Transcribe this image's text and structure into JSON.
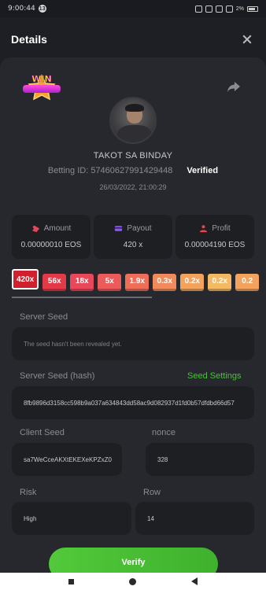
{
  "status_bar": {
    "time": "9:00:44",
    "notification_count": "13",
    "battery_text": "2%"
  },
  "header": {
    "title": "Details"
  },
  "bet": {
    "username": "TAKOT SA BINDAY",
    "betting_id": "Betting ID: 57460627991429448",
    "verified_label": "Verified",
    "date": "26/03/2022, 21:00:29",
    "badge_text": "WIN"
  },
  "stats": {
    "amount": {
      "label": "Amount",
      "value": "0.00000010 EOS",
      "icon": "coins-icon",
      "color": "#e8455a"
    },
    "payout": {
      "label": "Payout",
      "value": "420 x",
      "icon": "card-icon",
      "color": "#8c5cf0"
    },
    "profit": {
      "label": "Profit",
      "value": "0.00004190 EOS",
      "icon": "profit-icon",
      "color": "#e84545"
    }
  },
  "multipliers": [
    {
      "label": "420x",
      "color": "#d0202e",
      "active": true
    },
    {
      "label": "56x",
      "color": "#e23a48",
      "active": false
    },
    {
      "label": "18x",
      "color": "#e8485a",
      "active": false
    },
    {
      "label": "5x",
      "color": "#ec5a5a",
      "active": false
    },
    {
      "label": "1.9x",
      "color": "#ee6e5a",
      "active": false
    },
    {
      "label": "0.3x",
      "color": "#f08a5c",
      "active": false
    },
    {
      "label": "0.2x",
      "color": "#f3a35e",
      "active": false
    },
    {
      "label": "0.2x",
      "color": "#f5b863",
      "active": false
    },
    {
      "label": "0.2",
      "color": "#f3a35e",
      "active": false
    }
  ],
  "server_seed": {
    "label": "Server Seed",
    "value": "The seed hasn't been revealed yet."
  },
  "server_seed_hash": {
    "label": "Server Seed (hash)",
    "value": "8fb9896d3158cc598b9a037a634843dd58ac9d082937d1fd0b57dfdbd66d57",
    "settings_label": "Seed Settings"
  },
  "client_seed": {
    "label": "Client Seed",
    "value": "sa7WeCceAKXtEKEXeKPZxZ0"
  },
  "nonce": {
    "label": "nonce",
    "value": "328"
  },
  "risk": {
    "label": "Risk",
    "value": "High"
  },
  "row": {
    "label": "Row",
    "value": "14"
  },
  "verify_button": {
    "label": "Verify",
    "color": "#48c23a"
  }
}
